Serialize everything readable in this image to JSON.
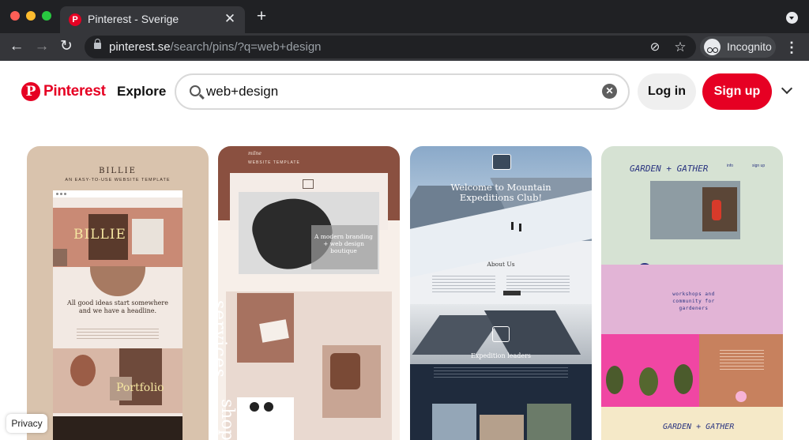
{
  "browser": {
    "tab": {
      "favicon": "P",
      "title": "Pinterest - Sverige",
      "close_icon": "✕"
    },
    "new_tab_icon": "+",
    "back_icon": "←",
    "forward_icon": "→",
    "reload_icon": "↻",
    "url": {
      "host": "pinterest.se",
      "path": "/search/pins/?q=web+design"
    },
    "eye_off_icon": "⊘",
    "star_icon": "☆",
    "profile_label": "Incognito",
    "menu_icon": "⋮"
  },
  "header": {
    "logo_badge": "P",
    "logo_text": "Pinterest",
    "explore_label": "Explore",
    "search": {
      "value": "web+design",
      "placeholder": "Search",
      "clear_icon": "✕"
    },
    "login_label": "Log in",
    "signup_label": "Sign up"
  },
  "pins": {
    "p1": {
      "title": "BILLIE",
      "subtitle": "AN EASY-TO-USE WEBSITE TEMPLATE",
      "hero_word": "BILLIE",
      "body_text": "All good ideas start somewhere and we have a headline.",
      "portfolio_word": "Portfolio"
    },
    "p2": {
      "brand": "milne",
      "template_label": "WEBSITE TEMPLATE",
      "headline": "A modern branding + web design boutique",
      "services_word": "services",
      "shop_word": "shop"
    },
    "p3": {
      "title": "Welcome to Mountain Expeditions Club!",
      "about_heading": "About Us",
      "leaders_heading": "Expedition leaders"
    },
    "p4": {
      "logo": "GARDEN + GATHER",
      "nav_1": "info",
      "nav_2": "sign up",
      "workshops": "workshops and community for gardeners",
      "bottom_logo": "GARDEN + GATHER"
    }
  },
  "privacy_label": "Privacy",
  "colors": {
    "brand_red": "#e60023",
    "chrome_dark": "#202124",
    "chrome_toolbar": "#35363a"
  }
}
